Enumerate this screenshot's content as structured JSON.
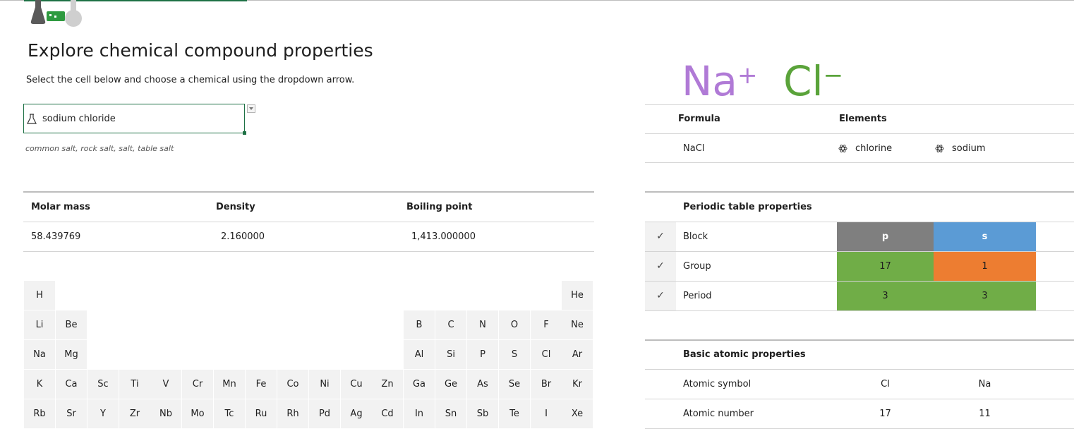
{
  "title": "Explore chemical compound properties",
  "subtitle": "Select the cell below and choose a chemical using the dropdown arrow.",
  "selector": {
    "value": "sodium chloride",
    "icon": "flask-icon"
  },
  "synonyms": "common salt, rock salt, salt, table salt",
  "properties": {
    "headers": [
      "Molar mass",
      "Density",
      "Boiling point"
    ],
    "values": [
      "58.439769",
      "2.160000",
      "1,413.000000"
    ]
  },
  "ions": {
    "cation": "Na",
    "cation_charge": "+",
    "anion": "Cl",
    "anion_charge": "−",
    "cation_color": "#b07ad6",
    "anion_color": "#5aa33a"
  },
  "formula_section": {
    "formula_header": "Formula",
    "elements_header": "Elements",
    "formula": "NaCl",
    "elements": [
      "chlorine",
      "sodium"
    ]
  },
  "periodic_section": {
    "title": "Periodic table properties",
    "rows": [
      {
        "label": "Block",
        "check": "✓",
        "values": [
          "p",
          "s"
        ],
        "colors": [
          "#7f7f7f",
          "#5b9bd5"
        ]
      },
      {
        "label": "Group",
        "check": "✓",
        "values": [
          "17",
          "1"
        ],
        "colors": [
          "#70ad47",
          "#ed7d31"
        ]
      },
      {
        "label": "Period",
        "check": "✓",
        "values": [
          "3",
          "3"
        ],
        "colors": [
          "#70ad47",
          "#70ad47"
        ]
      }
    ]
  },
  "atomic_section": {
    "title": "Basic atomic properties",
    "rows": [
      {
        "label": "Atomic symbol",
        "values": [
          "Cl",
          "Na"
        ]
      },
      {
        "label": "Atomic number",
        "values": [
          "17",
          "11"
        ]
      }
    ]
  },
  "periodic_table": {
    "rows": [
      [
        "H",
        "",
        "",
        "",
        "",
        "",
        "",
        "",
        "",
        "",
        "",
        "",
        "",
        "",
        "",
        "",
        "",
        "He"
      ],
      [
        "Li",
        "Be",
        "",
        "",
        "",
        "",
        "",
        "",
        "",
        "",
        "",
        "",
        "B",
        "C",
        "N",
        "O",
        "F",
        "Ne"
      ],
      [
        "Na",
        "Mg",
        "",
        "",
        "",
        "",
        "",
        "",
        "",
        "",
        "",
        "",
        "Al",
        "Si",
        "P",
        "S",
        "Cl",
        "Ar"
      ],
      [
        "K",
        "Ca",
        "Sc",
        "Ti",
        "V",
        "Cr",
        "Mn",
        "Fe",
        "Co",
        "Ni",
        "Cu",
        "Zn",
        "Ga",
        "Ge",
        "As",
        "Se",
        "Br",
        "Kr"
      ],
      [
        "Rb",
        "Sr",
        "Y",
        "Zr",
        "Nb",
        "Mo",
        "Tc",
        "Ru",
        "Rh",
        "Pd",
        "Ag",
        "Cd",
        "In",
        "Sn",
        "Sb",
        "Te",
        "I",
        "Xe"
      ]
    ]
  }
}
